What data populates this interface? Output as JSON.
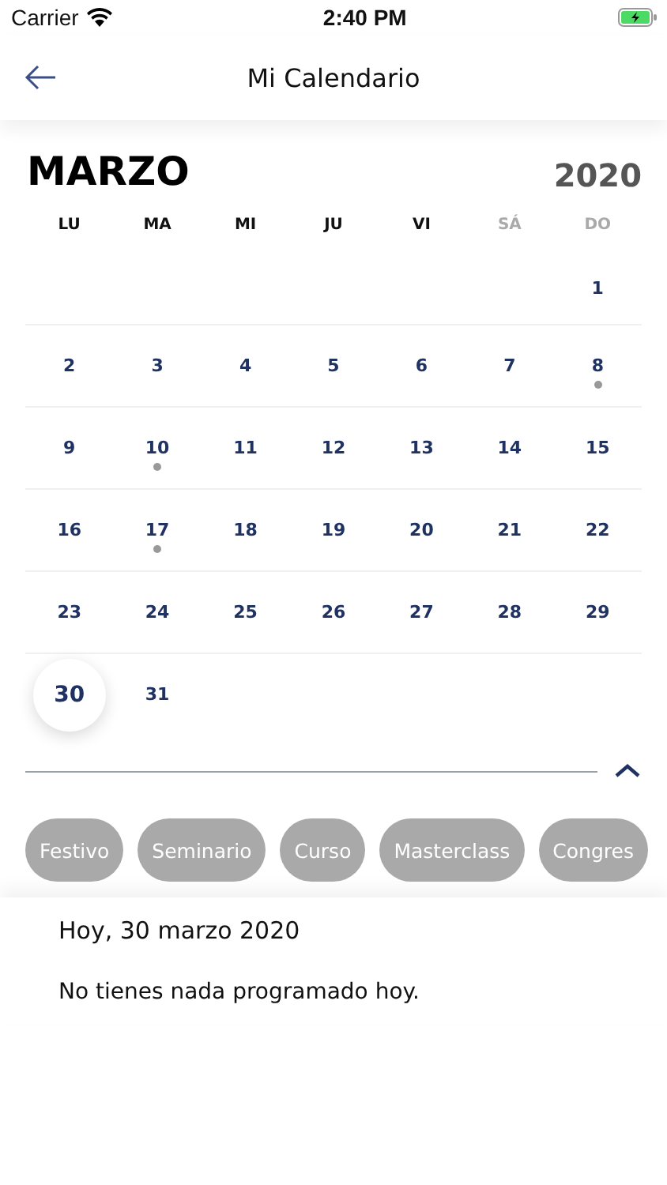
{
  "status_bar": {
    "carrier": "Carrier",
    "time": "2:40 PM"
  },
  "nav": {
    "title": "Mi Calendario"
  },
  "calendar": {
    "month": "MARZO",
    "year": "2020",
    "weekdays": [
      {
        "label": "LU",
        "weekend": false
      },
      {
        "label": "MA",
        "weekend": false
      },
      {
        "label": "MI",
        "weekend": false
      },
      {
        "label": "JU",
        "weekend": false
      },
      {
        "label": "VI",
        "weekend": false
      },
      {
        "label": "SÁ",
        "weekend": true
      },
      {
        "label": "DO",
        "weekend": true
      }
    ],
    "weeks": [
      {
        "kind": "start",
        "days": [
          {
            "day": "1",
            "event": false,
            "selected": false
          }
        ]
      },
      {
        "kind": "full",
        "days": [
          {
            "day": "2",
            "event": false,
            "selected": false
          },
          {
            "day": "3",
            "event": false,
            "selected": false
          },
          {
            "day": "4",
            "event": false,
            "selected": false
          },
          {
            "day": "5",
            "event": false,
            "selected": false
          },
          {
            "day": "6",
            "event": false,
            "selected": false
          },
          {
            "day": "7",
            "event": false,
            "selected": false
          },
          {
            "day": "8",
            "event": true,
            "selected": false
          }
        ]
      },
      {
        "kind": "full",
        "days": [
          {
            "day": "9",
            "event": false,
            "selected": false
          },
          {
            "day": "10",
            "event": true,
            "selected": false
          },
          {
            "day": "11",
            "event": false,
            "selected": false
          },
          {
            "day": "12",
            "event": false,
            "selected": false
          },
          {
            "day": "13",
            "event": false,
            "selected": false
          },
          {
            "day": "14",
            "event": false,
            "selected": false
          },
          {
            "day": "15",
            "event": false,
            "selected": false
          }
        ]
      },
      {
        "kind": "full",
        "days": [
          {
            "day": "16",
            "event": false,
            "selected": false
          },
          {
            "day": "17",
            "event": true,
            "selected": false
          },
          {
            "day": "18",
            "event": false,
            "selected": false
          },
          {
            "day": "19",
            "event": false,
            "selected": false
          },
          {
            "day": "20",
            "event": false,
            "selected": false
          },
          {
            "day": "21",
            "event": false,
            "selected": false
          },
          {
            "day": "22",
            "event": false,
            "selected": false
          }
        ]
      },
      {
        "kind": "full",
        "days": [
          {
            "day": "23",
            "event": false,
            "selected": false
          },
          {
            "day": "24",
            "event": false,
            "selected": false
          },
          {
            "day": "25",
            "event": false,
            "selected": false
          },
          {
            "day": "26",
            "event": false,
            "selected": false
          },
          {
            "day": "27",
            "event": false,
            "selected": false
          },
          {
            "day": "28",
            "event": false,
            "selected": false
          },
          {
            "day": "29",
            "event": false,
            "selected": false
          }
        ]
      },
      {
        "kind": "end",
        "days": [
          {
            "day": "30",
            "event": false,
            "selected": true
          },
          {
            "day": "31",
            "event": false,
            "selected": false
          }
        ]
      }
    ],
    "expanded": true
  },
  "filters": [
    {
      "label": "Festivo",
      "selected": false
    },
    {
      "label": "Seminario",
      "selected": false
    },
    {
      "label": "Curso",
      "selected": false
    },
    {
      "label": "Masterclass",
      "selected": false
    },
    {
      "label": "Congres",
      "selected": false
    }
  ],
  "agenda": {
    "date": "Hoy, 30 marzo 2020",
    "message": "No tienes nada programado hoy."
  }
}
